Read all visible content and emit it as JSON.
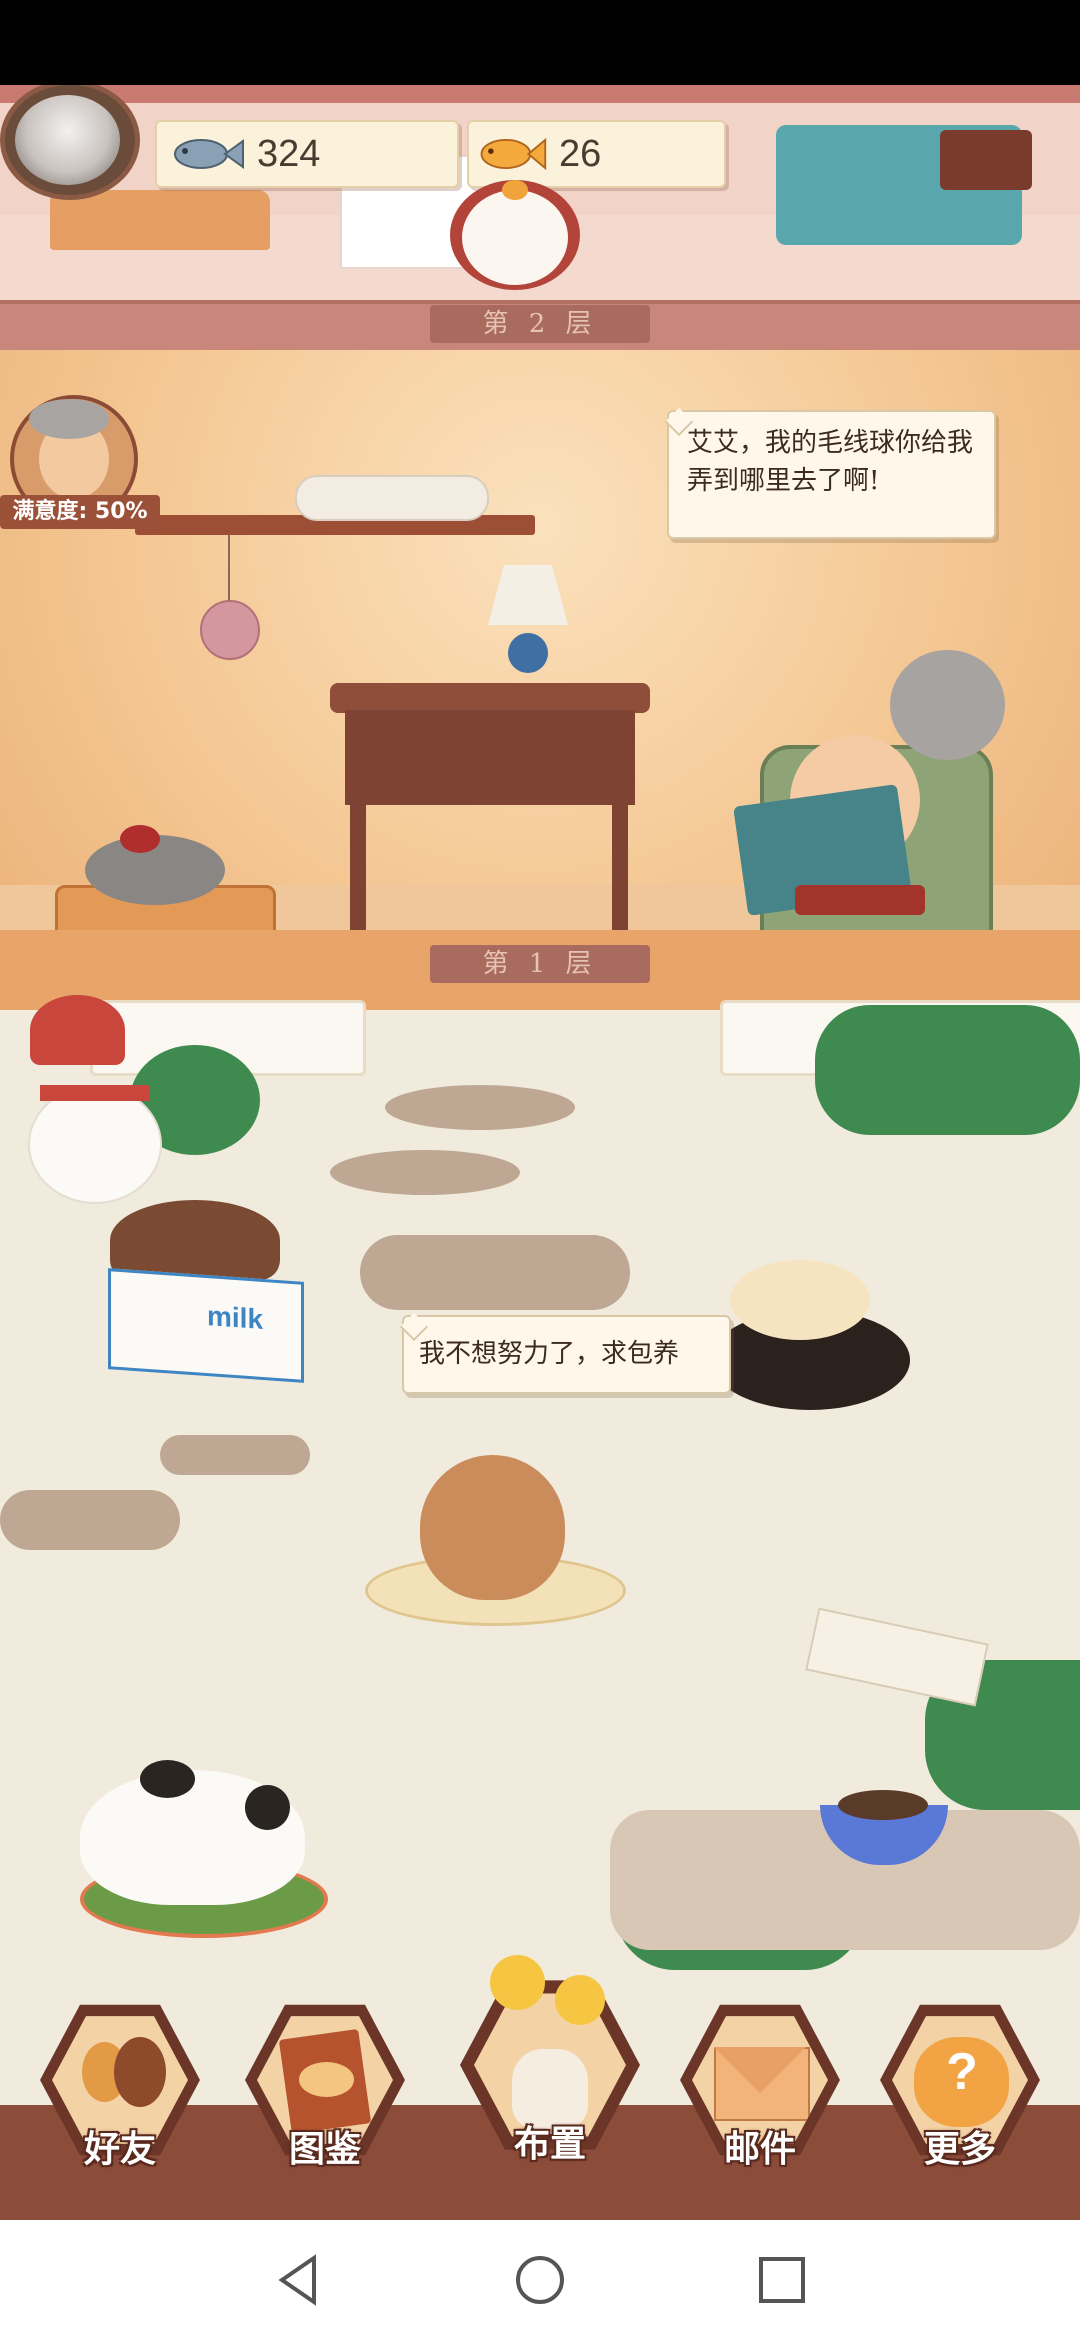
{
  "currency": {
    "fish_silver": "324",
    "fish_gold": "26"
  },
  "floors": {
    "floor2_label": "第 2 层",
    "floor1_label": "第 1 层"
  },
  "grandma": {
    "satisfaction": "满意度: 50%",
    "speech": "艾艾，我的毛线球你给我弄到哪里去了啊!"
  },
  "cat_speech": "我不想努力了，求包养",
  "milk_box_label": "milk",
  "menu": [
    {
      "label": "好友",
      "icon": "friends-icon"
    },
    {
      "label": "图鉴",
      "icon": "catalog-book-icon"
    },
    {
      "label": "布置",
      "icon": "flower-vase-icon"
    },
    {
      "label": "邮件",
      "icon": "mail-envelope-icon"
    },
    {
      "label": "更多",
      "icon": "question-cat-icon"
    }
  ],
  "colors": {
    "menu_bar": "#8b4c3a",
    "floor2_bg": "#f4c793",
    "yard_bg": "#f1ebdd"
  }
}
